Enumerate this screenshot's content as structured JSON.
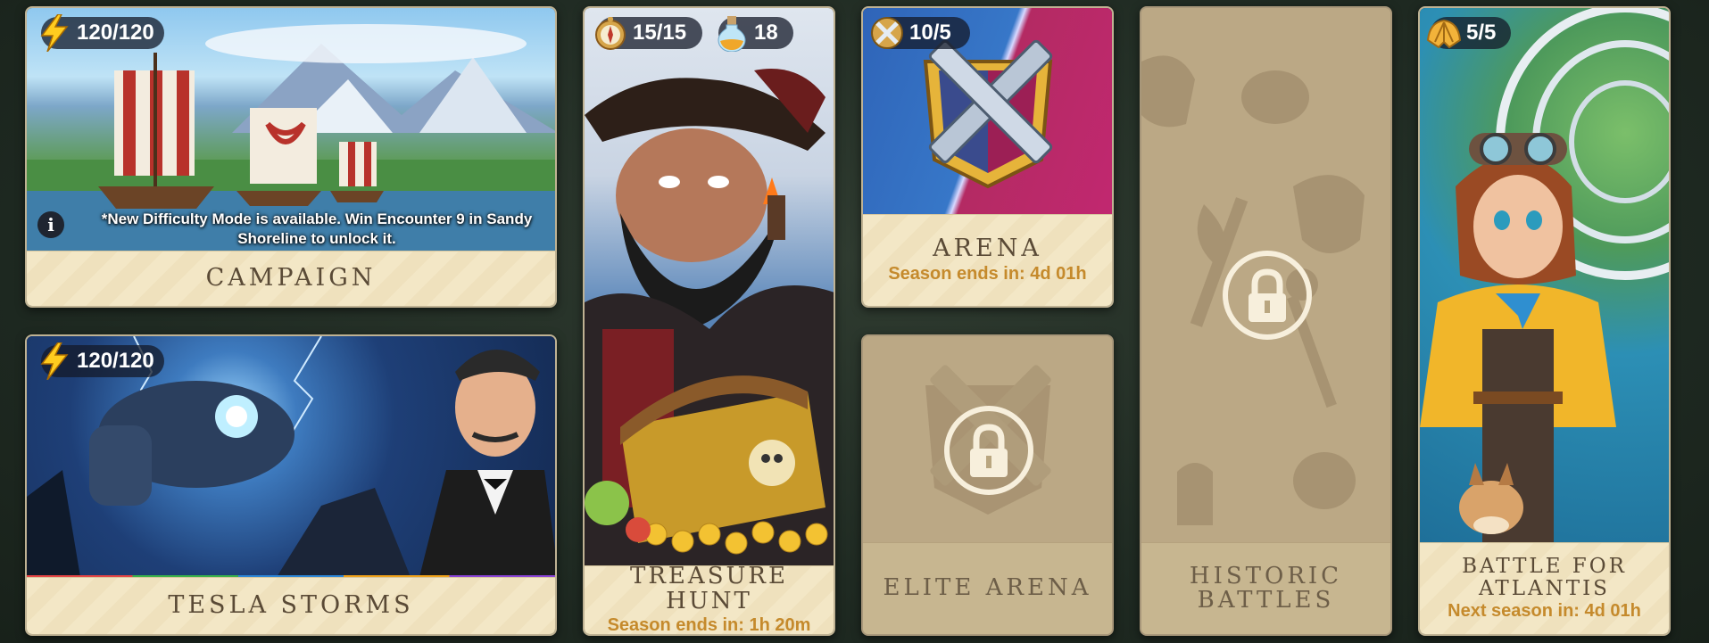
{
  "campaign": {
    "title": "CAMPAIGN",
    "energy": "120/120",
    "notice": "*New Difficulty Mode is available. Win Encounter 9 in Sandy Shoreline to unlock it."
  },
  "tesla": {
    "title": "TESLA STORMS",
    "energy": "120/120"
  },
  "treasure": {
    "title": "TREASURE HUNT",
    "subtitle": "Season ends in: 1h 20m",
    "compass": "15/15",
    "potion": "18"
  },
  "arena": {
    "title": "ARENA",
    "subtitle": "Season ends in: 4d 01h",
    "tickets": "10/5"
  },
  "elite_arena": {
    "title": "ELITE ARENA"
  },
  "historic": {
    "title": "HISTORIC BATTLES"
  },
  "atlantis": {
    "title": "BATTLE FOR ATLANTIS",
    "subtitle": "Next season in: 4d 01h",
    "shells": "5/5"
  },
  "colors": {
    "label_bg": "#f3e7c6",
    "title_text": "#5a4a36",
    "subtitle_text": "#c58a2c",
    "locked_bg": "#b9a680"
  },
  "icons": [
    "lightning-icon",
    "compass-icon",
    "potion-icon",
    "crossed-swords-icon",
    "shell-icon",
    "info-icon",
    "lock-icon"
  ]
}
